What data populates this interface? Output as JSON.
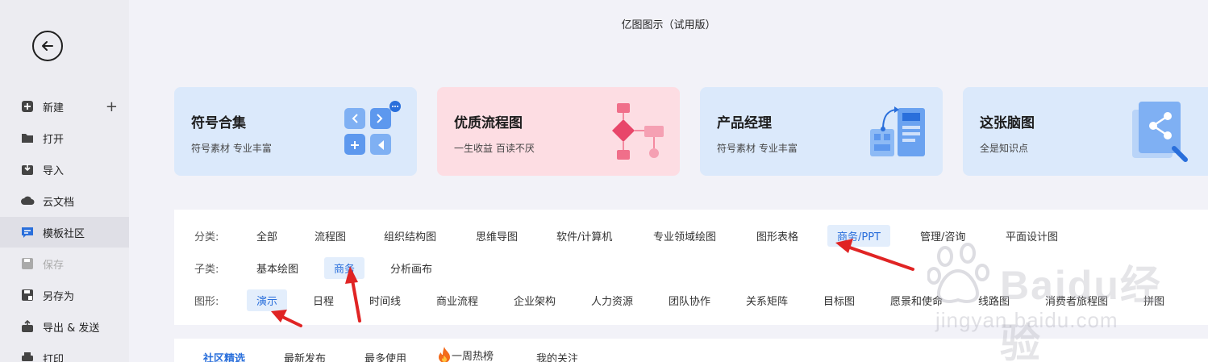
{
  "app": {
    "title": "亿图图示（试用版）"
  },
  "sidebar": {
    "items": [
      {
        "label": "新建",
        "icon": "plus-square-icon"
      },
      {
        "label": "打开",
        "icon": "folder-icon"
      },
      {
        "label": "导入",
        "icon": "import-icon"
      },
      {
        "label": "云文档",
        "icon": "cloud-icon"
      },
      {
        "label": "模板社区",
        "icon": "chat-icon",
        "active": true
      },
      {
        "label": "保存",
        "icon": "save-icon",
        "disabled": true
      },
      {
        "label": "另存为",
        "icon": "save-as-icon"
      },
      {
        "label": "导出 & 发送",
        "icon": "export-icon"
      },
      {
        "label": "打印",
        "icon": "print-icon"
      }
    ]
  },
  "cards": [
    {
      "title": "符号合集",
      "subtitle": "符号素材 专业丰富"
    },
    {
      "title": "优质流程图",
      "subtitle": "一生收益 百读不厌"
    },
    {
      "title": "产品经理",
      "subtitle": "符号素材 专业丰富"
    },
    {
      "title": "这张脑图",
      "subtitle": "全是知识点"
    }
  ],
  "filters": {
    "category_label": "分类:",
    "categories": [
      "全部",
      "流程图",
      "组织结构图",
      "思维导图",
      "软件/计算机",
      "专业领域绘图",
      "图形表格",
      "商务/PPT",
      "管理/咨询",
      "平面设计图"
    ],
    "category_selected": "商务/PPT",
    "subcategory_label": "子类:",
    "subcategories": [
      "基本绘图",
      "商务",
      "分析画布"
    ],
    "subcategory_selected": "商务",
    "shape_label": "图形:",
    "shapes": [
      "演示",
      "日程",
      "时间线",
      "商业流程",
      "企业架构",
      "人力资源",
      "团队协作",
      "关系矩阵",
      "目标图",
      "愿景和使命",
      "线路图",
      "消费者旅程图",
      "拼图"
    ],
    "shape_selected": "演示"
  },
  "tabs": [
    "社区精选",
    "最新发布",
    "最多使用",
    "一周热榜",
    "我的关注"
  ],
  "watermark": {
    "brand": "Baidu经验",
    "url": "jingyan.baidu.com"
  },
  "colors": {
    "accent": "#2a6fdb",
    "arrow": "#e02424",
    "card_blue": "#dbe9fb",
    "card_pink": "#fddde3"
  }
}
